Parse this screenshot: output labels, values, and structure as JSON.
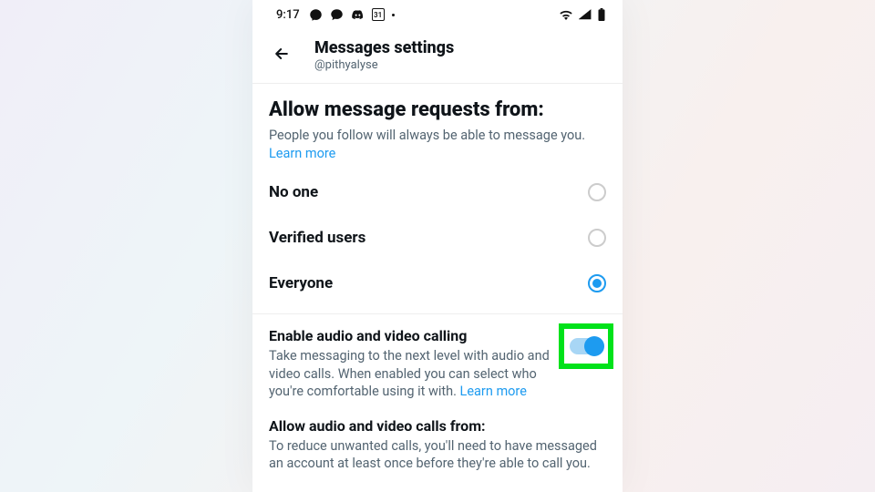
{
  "statusbar": {
    "time": "9:17",
    "calendar_badge": "31"
  },
  "header": {
    "title": "Messages settings",
    "username": "@pithyalyse"
  },
  "section_requests": {
    "title": "Allow message requests from:",
    "desc": "People you follow will always be able to message you. ",
    "learn_more": "Learn more"
  },
  "radio_options": {
    "items": [
      {
        "label": "No one",
        "selected": false
      },
      {
        "label": "Verified users",
        "selected": false
      },
      {
        "label": "Everyone",
        "selected": true
      }
    ]
  },
  "toggle_section": {
    "title": "Enable audio and video calling",
    "desc": "Take messaging to the next level with audio and video calls. When enabled you can select who you're comfortable using it with. ",
    "learn_more": "Learn more"
  },
  "sub_section": {
    "title": "Allow audio and video calls from:",
    "desc": "To reduce unwanted calls, you'll need to have messaged an account at least once before they're able to call you."
  }
}
